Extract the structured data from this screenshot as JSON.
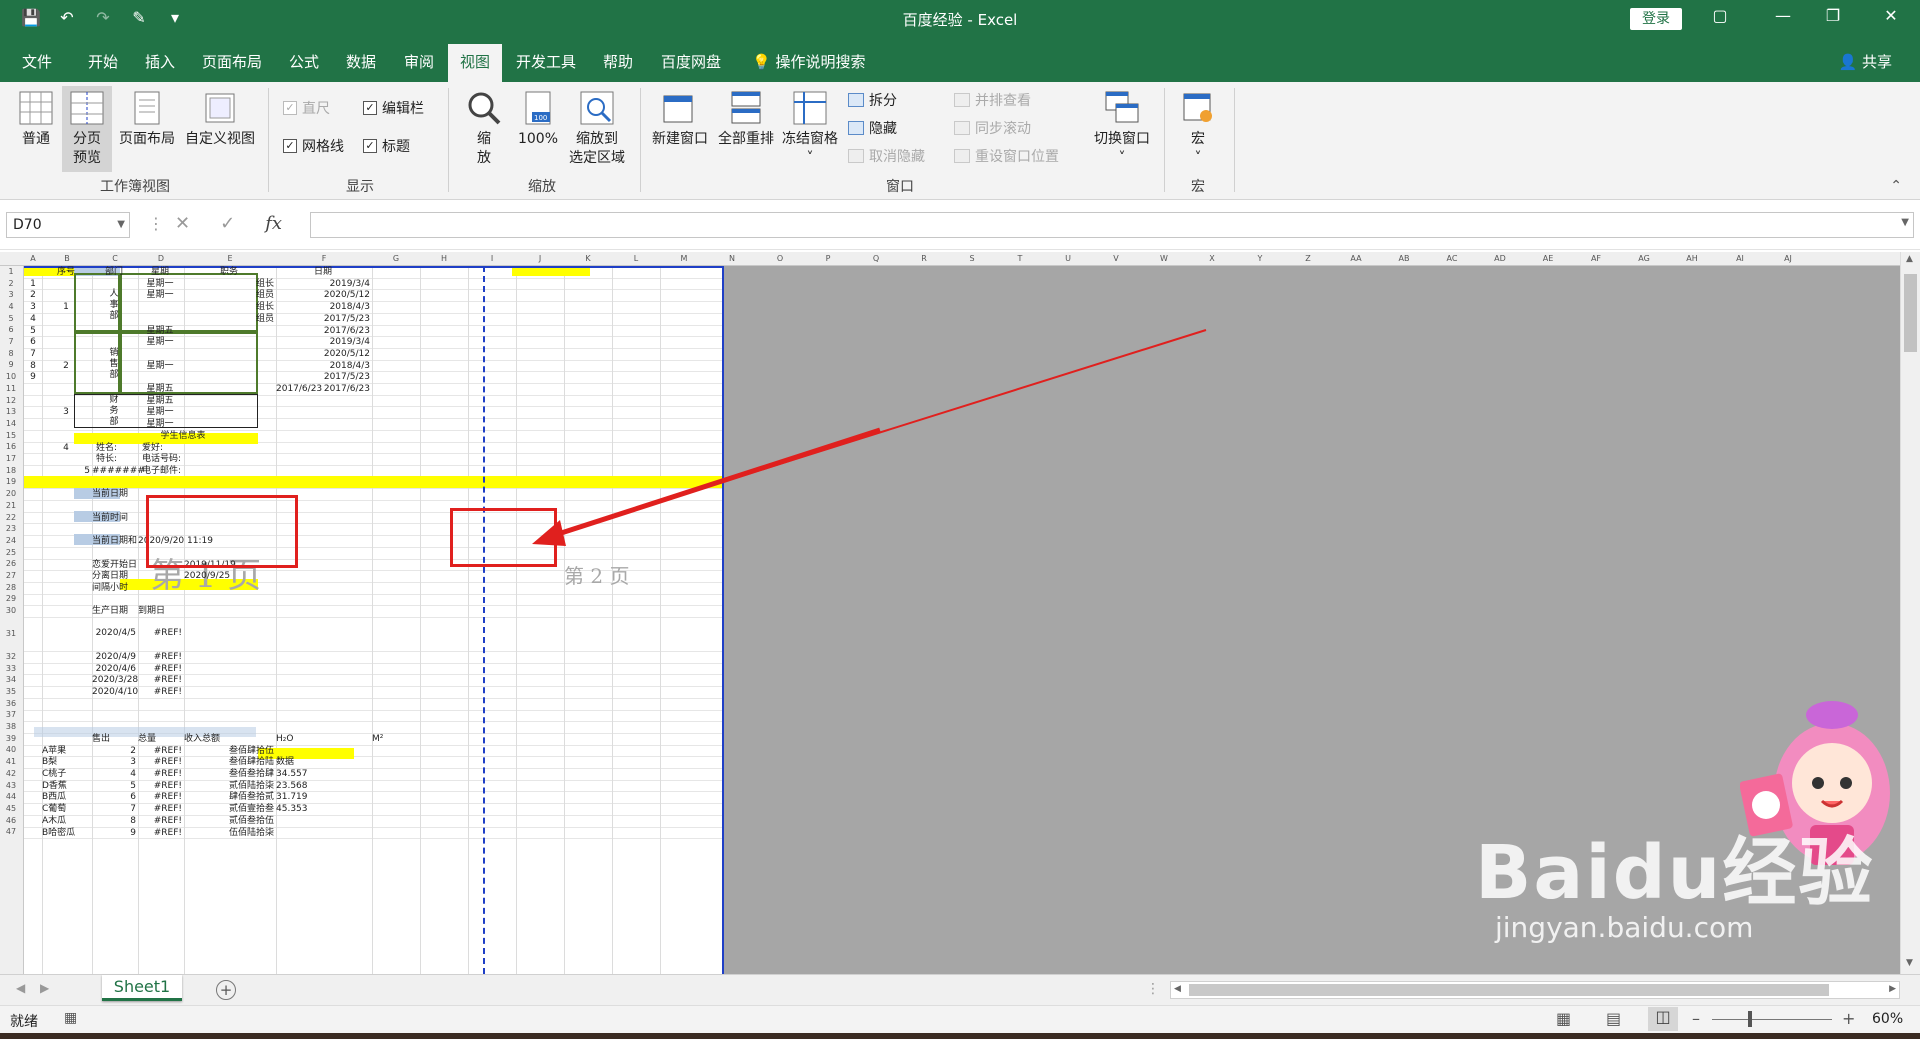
{
  "window": {
    "title": "百度经验 - Excel",
    "login_label": "登录",
    "qat_icons": [
      "save-icon",
      "undo-icon",
      "redo-icon",
      "format-painter-icon",
      "customize-icon"
    ]
  },
  "tabs": [
    "文件",
    "开始",
    "插入",
    "页面布局",
    "公式",
    "数据",
    "审阅",
    "视图",
    "开发工具",
    "帮助",
    "百度网盘",
    "操作说明搜索"
  ],
  "active_tab": "视图",
  "share_label": "共享",
  "ribbon": {
    "workbook_views": {
      "group_label": "工作簿视图",
      "normal": "普通",
      "page_break_preview_1": "分页",
      "page_break_preview_2": "预览",
      "page_layout": "页面布局",
      "custom_views": "自定义视图"
    },
    "show": {
      "group_label": "显示",
      "ruler": "直尺",
      "formula_bar": "编辑栏",
      "gridlines": "网格线",
      "headings": "标题"
    },
    "zoom": {
      "group_label": "缩放",
      "zoom_1": "缩",
      "zoom_2": "放",
      "zoom_100": "100%",
      "zoom_selection_1": "缩放到",
      "zoom_selection_2": "选定区域"
    },
    "window": {
      "group_label": "窗口",
      "new_window": "新建窗口",
      "arrange_all": "全部重排",
      "freeze_panes": "冻结窗格",
      "split": "拆分",
      "hide": "隐藏",
      "unhide": "取消隐藏",
      "view_side_by_side": "并排查看",
      "sync_scroll": "同步滚动",
      "reset_position": "重设窗口位置",
      "switch_windows": "切换窗口"
    },
    "macros": {
      "group_label": "宏",
      "macros": "宏"
    }
  },
  "formula_bar": {
    "name_box": "D70",
    "cancel_symbol": "✕",
    "enter_symbol": "✓",
    "fx_symbol": "fx",
    "formula": ""
  },
  "column_headers": [
    "A",
    "B",
    "C",
    "D",
    "E",
    "F",
    "G",
    "H",
    "I",
    "J",
    "K",
    "L",
    "M",
    "N",
    "O",
    "P",
    "Q",
    "R",
    "S",
    "T",
    "U",
    "V",
    "W",
    "X",
    "Y",
    "Z",
    "AA",
    "AB",
    "AC",
    "AD",
    "AE",
    "AF",
    "AG",
    "AH",
    "AI",
    "AJ"
  ],
  "row_numbers": [
    "1",
    "2",
    "3",
    "4",
    "5",
    "6",
    "7",
    "8",
    "9",
    "10",
    "11",
    "12",
    "13",
    "14",
    "15",
    "16",
    "17",
    "18",
    "19",
    "20",
    "21",
    "22",
    "23",
    "24",
    "25",
    "26",
    "27",
    "28",
    "29",
    "30",
    "31",
    "32",
    "33",
    "34",
    "35",
    "36",
    "37",
    "38",
    "39",
    "40",
    "41",
    "42",
    "43",
    "44",
    "45",
    "46",
    "47"
  ],
  "cells": {
    "header": [
      "序号",
      "部门",
      "星期",
      "职务",
      "日期"
    ],
    "row_index": [
      "1",
      "2",
      "3",
      "4",
      "5",
      "6",
      "7",
      "8",
      "9"
    ],
    "group_ids": [
      "1",
      "2",
      "3",
      "4",
      "5"
    ],
    "departments": [
      "人\n事\n部",
      "销\n售\n部",
      "财\n务\n部"
    ],
    "weekdays": [
      "星期一",
      "星期一",
      "星期五",
      "星期一",
      "星期一",
      "星期五",
      "星期五",
      "星期一",
      "星期一"
    ],
    "positions": [
      "组长",
      "组员",
      "组长",
      "组员"
    ],
    "dates": [
      "2019/3/4",
      "2020/5/12",
      "2018/4/3",
      "2017/5/23",
      "2017/6/23",
      "2019/3/4",
      "2020/5/12",
      "2018/4/3",
      "2017/5/23",
      "2017/6/23"
    ],
    "student_title": "学生信息表",
    "student_fields": [
      "姓名:",
      "爱好:",
      "特长:",
      "电话号码:",
      "电子邮件:"
    ],
    "hash_overflow": "#######",
    "current_date": "当前日期",
    "current_time": "当前时间",
    "current_datetime": "当前日期和",
    "datetime_value": "2020/9/20 11:19",
    "love_start": "恋爱开始日",
    "love_start_value": "2019/11/19",
    "breakup_date": "分离日期",
    "breakup_value": "2020/9/25",
    "interval_hours": "间隔小时",
    "production_date": "生产日期",
    "expiry_date": "到期日",
    "production_dates": [
      "2020/4/5",
      "2020/4/9",
      "2020/4/6",
      "2020/3/28",
      "2020/4/10"
    ],
    "ref_error": "#REF!",
    "sales_header": [
      "售出",
      "总量",
      "收入总额",
      "H₂O",
      "M²"
    ],
    "fruits": [
      "A苹果",
      "B梨",
      "C桃子",
      "D香蕉",
      "B西瓜",
      "C葡萄",
      "A木瓜",
      "B哈密瓜"
    ],
    "qty": [
      "2",
      "3",
      "4",
      "5",
      "6",
      "7",
      "8",
      "9"
    ],
    "income_text": [
      "叁佰肆拾伍",
      "叁佰肆拾陆",
      "叁佰叁拾肆",
      "贰佰陆拾柒",
      "肆佰叁拾贰",
      "贰佰壹拾叁",
      "贰佰叁拾伍",
      "伍佰陆拾柒"
    ],
    "data_label": "数据",
    "decimals": [
      "34.557",
      "23.568",
      "31.719",
      "45.353"
    ]
  },
  "page_labels": {
    "page1": "第 1 页",
    "page2": "第 2 页"
  },
  "sheet_tab": "Sheet1",
  "status": {
    "ready": "就绪",
    "zoom": "60%"
  },
  "watermark": {
    "brand": "Baidu经验",
    "url": "jingyan.baidu.com"
  },
  "colors": {
    "excel_green": "#217346",
    "highlight_yellow": "#ffff00",
    "page_break_blue": "#1f3fc6",
    "annotation_red": "#e0201e"
  }
}
